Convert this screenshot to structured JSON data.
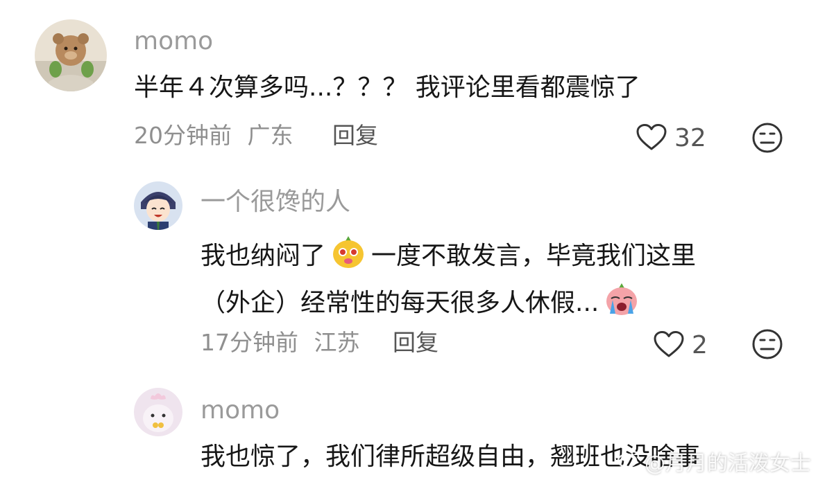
{
  "comments": [
    {
      "username": "momo",
      "text": "半年４次算多吗...？？？ 我评论里看都震惊了",
      "time": "20分钟前",
      "location": "广东",
      "reply_label": "回复",
      "likes": "32"
    }
  ],
  "replies": [
    {
      "username": "一个很馋的人",
      "line1_before": "我也纳闷了",
      "line1_after": "一度不敢发言，毕竟我们这里",
      "line2": "（外企）经常性的每天很多人休假...",
      "time": "17分钟前",
      "location": "江苏",
      "reply_label": "回复",
      "likes": "2"
    },
    {
      "username": "momo",
      "text": "我也惊了，我们律所超级自由，翘班也没啥事"
    }
  ],
  "watermark": "@月月的活泼女士",
  "icons": {
    "like": "heart-outline-icon",
    "dislike": "meh-face-icon",
    "emoji1": "yellow-face-emoji",
    "emoji2": "crying-face-emoji"
  }
}
